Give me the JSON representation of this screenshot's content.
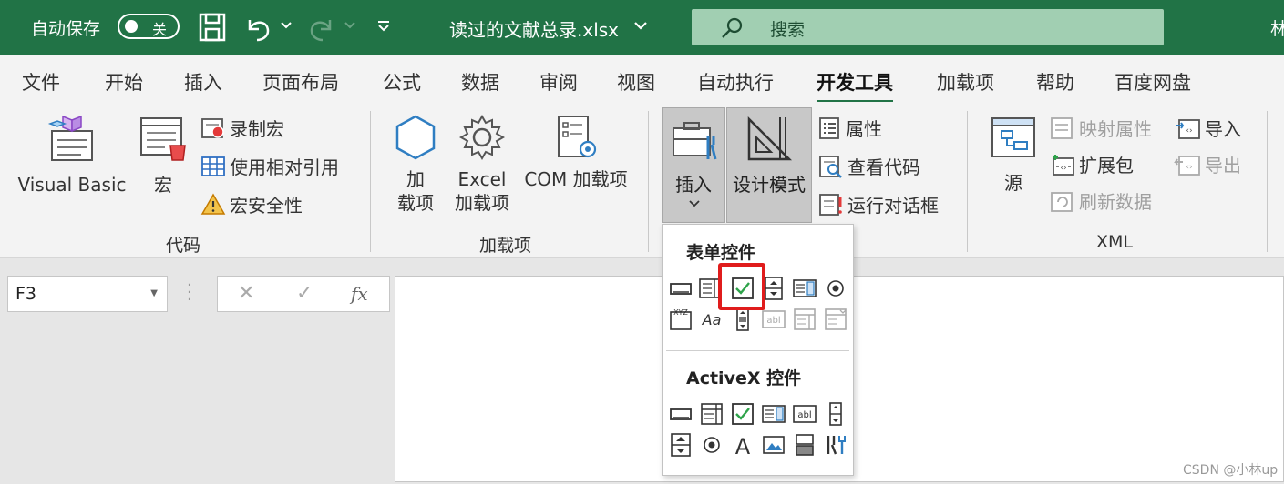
{
  "titlebar": {
    "autosave_label": "自动保存",
    "toggle_text": "关",
    "filename": "读过的文献总录.xlsx",
    "search_label": "搜索",
    "user_initial": "林",
    "bg_color": "#217346"
  },
  "tabs": [
    "文件",
    "开始",
    "插入",
    "页面布局",
    "公式",
    "数据",
    "审阅",
    "视图",
    "自动执行",
    "开发工具",
    "加载项",
    "帮助",
    "百度网盘"
  ],
  "active_tab": "开发工具",
  "ribbon": {
    "code": {
      "label": "代码",
      "visual_basic": "Visual Basic",
      "macros": "宏",
      "record_macro": "录制宏",
      "relative_ref": "使用相对引用",
      "macro_security": "宏安全性"
    },
    "addins": {
      "label": "加载项",
      "addins_line1": "加",
      "addins_line2": "载项",
      "excel_line1": "Excel",
      "excel_line2": "加载项",
      "com": "COM 加载项"
    },
    "controls": {
      "insert": "插入",
      "design_mode": "设计模式",
      "properties": "属性",
      "view_code": "查看代码",
      "run_dialog": "运行对话框"
    },
    "xml": {
      "label": "XML",
      "source": "源",
      "map_props": "映射属性",
      "expansion": "扩展包",
      "refresh": "刷新数据",
      "import": "导入",
      "export": "导出"
    }
  },
  "formula_bar": {
    "name_box": "F3",
    "cancel_icon": "✕",
    "enter_icon": "✓",
    "fx": "fx"
  },
  "dropdown": {
    "form_controls_title": "表单控件",
    "activex_title": "ActiveX 控件"
  },
  "watermark": "CSDN @小林up"
}
